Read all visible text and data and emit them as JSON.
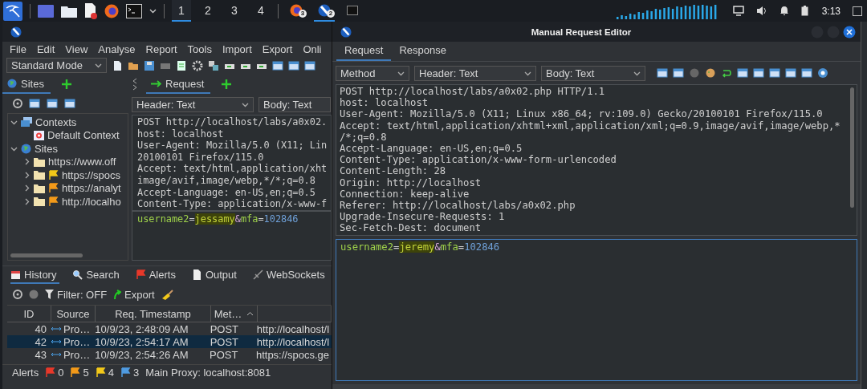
{
  "taskbar": {
    "workspaces": [
      {
        "label": "1",
        "selected": true
      },
      {
        "label": "2",
        "selected": false
      },
      {
        "label": "3",
        "selected": false
      },
      {
        "label": "4",
        "selected": false
      }
    ],
    "tasks": [
      {
        "badge": "3",
        "selected": false
      },
      {
        "badge": "2",
        "selected": true
      },
      {
        "selected": false
      }
    ],
    "clock": "3:13"
  },
  "zap": {
    "menu": [
      "File",
      "Edit",
      "View",
      "Analyse",
      "Report",
      "Tools",
      "Import",
      "Export",
      "Onli"
    ],
    "mode": "Standard Mode",
    "sites_tab": "Sites",
    "request_tab": "Request",
    "header_select": "Header: Text",
    "body_select": "Body: Text",
    "tree": [
      {
        "kind": "contexts",
        "label": "Contexts",
        "expanded": true,
        "children": [
          {
            "kind": "context",
            "label": "Default Context"
          }
        ]
      },
      {
        "kind": "sites",
        "label": "Sites",
        "expanded": true,
        "children": [
          {
            "kind": "site",
            "label": "https://www.off",
            "expanded": false
          },
          {
            "kind": "site",
            "label": "https://spocs",
            "expanded": false,
            "color": "#f2c81a"
          },
          {
            "kind": "site",
            "label": "https://analyt",
            "expanded": false,
            "color": "#f39a1a"
          },
          {
            "kind": "site",
            "label": "http://localho",
            "expanded": false,
            "color": "#f39a1a"
          }
        ]
      }
    ],
    "request_lines": [
      "POST http://localhost/labs/a0x02.",
      "host: localhost",
      "User-Agent: Mozilla/5.0 (X11; Lin",
      "20100101 Firefox/115.0",
      "Accept: text/html,application/xht",
      "image/avif,image/webp,*/*;q=0.8",
      "Accept-Language: en-US,en;q=0.5",
      "Content-Type: application/x-www-f"
    ],
    "body": [
      {
        "kind": "name",
        "text": "username2",
        "highlighted": false
      },
      {
        "kind": "op",
        "text": "=",
        "highlighted": false
      },
      {
        "kind": "value",
        "text": "jessamy",
        "highlighted": true
      },
      {
        "kind": "amp",
        "text": "&",
        "highlighted": false
      },
      {
        "kind": "name",
        "text": "mfa",
        "highlighted": false
      },
      {
        "kind": "op",
        "text": "=",
        "highlighted": false
      },
      {
        "kind": "number",
        "text": "102846",
        "highlighted": false
      }
    ],
    "bottom_tabs": [
      {
        "kind": "history",
        "label": "History",
        "selected": true
      },
      {
        "kind": "search",
        "label": "Search",
        "selected": false
      },
      {
        "kind": "alerts",
        "label": "Alerts",
        "selected": false
      },
      {
        "kind": "output",
        "label": "Output",
        "selected": false
      },
      {
        "kind": "websockets",
        "label": "WebSockets",
        "selected": false
      }
    ],
    "filter": "Filter: OFF",
    "export": "Export",
    "columns": [
      "ID",
      "Source",
      "Req. Timestamp",
      "Met…"
    ],
    "rows": [
      {
        "id": "40",
        "source": "Pro…",
        "timestamp": "10/9/23, 2:48:09 AM",
        "method": "POST",
        "url": "http://localhost/l",
        "selected": false
      },
      {
        "id": "42",
        "source": "Pro…",
        "timestamp": "10/9/23, 2:54:17 AM",
        "method": "POST",
        "url": "http://localhost/l",
        "selected": true
      },
      {
        "id": "43",
        "source": "Pro…",
        "timestamp": "10/9/23, 2:54:26 AM",
        "method": "POST",
        "url": "https://spocs.ge",
        "selected": false
      }
    ],
    "status": {
      "label": "Alerts",
      "alerts": [
        {
          "count": "0",
          "color": "#e8382a"
        },
        {
          "count": "5",
          "color": "#f39a1a"
        },
        {
          "count": "4",
          "color": "#f2c81a"
        },
        {
          "count": "3",
          "color": "#4f9be0"
        }
      ],
      "proxy": "Main Proxy: localhost:8081"
    }
  },
  "dialog": {
    "title": "Manual Request Editor",
    "tabs": [
      {
        "label": "Request",
        "selected": true
      },
      {
        "label": "Response",
        "selected": false
      }
    ],
    "selects": [
      "Method",
      "Header: Text",
      "Body: Text"
    ],
    "header_lines": [
      "POST http://localhost/labs/a0x02.php HTTP/1.1",
      "host: localhost",
      "User-Agent: Mozilla/5.0 (X11; Linux x86_64; rv:109.0) Gecko/20100101 Firefox/115.0",
      "Accept: text/html,application/xhtml+xml,application/xml;q=0.9,image/avif,image/webp,*",
      "/*;q=0.8",
      "Accept-Language: en-US,en;q=0.5",
      "Content-Type: application/x-www-form-urlencoded",
      "Content-Length: 28",
      "Origin: http://localhost",
      "Connection: keep-alive",
      "Referer: http://localhost/labs/a0x02.php",
      "Upgrade-Insecure-Requests: 1",
      "Sec-Fetch-Dest: document"
    ],
    "body": [
      {
        "kind": "name",
        "text": "username2",
        "highlighted": false
      },
      {
        "kind": "op",
        "text": "=",
        "highlighted": false
      },
      {
        "kind": "value",
        "text": "jeremy",
        "highlighted": true
      },
      {
        "kind": "amp",
        "text": "&",
        "highlighted": false
      },
      {
        "kind": "name",
        "text": "mfa",
        "highlighted": false
      },
      {
        "kind": "op",
        "text": "=",
        "highlighted": false
      },
      {
        "kind": "number",
        "text": "102846",
        "highlighted": false
      }
    ]
  }
}
